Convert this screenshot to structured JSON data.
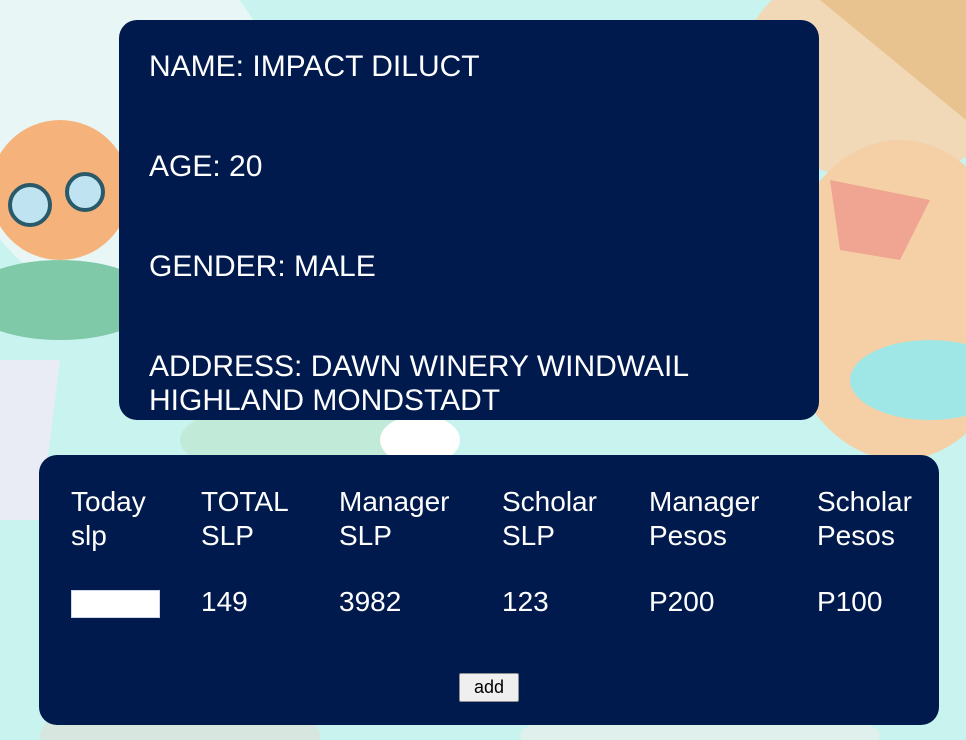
{
  "profile": {
    "name_label": "NAME:",
    "name_value": "IMPACT DILUCT",
    "age_label": "AGE:",
    "age_value": "20",
    "gender_label": "GENDER:",
    "gender_value": "MALE",
    "address_label": "ADDRESS:",
    "address_value": "DAWN WINERY WINDWAIL HIGHLAND MONDSTADT"
  },
  "slp_table": {
    "columns": [
      {
        "header": "Today slp",
        "value": ""
      },
      {
        "header": "TOTAL SLP",
        "value": "149"
      },
      {
        "header": "Manager SLP",
        "value": "3982"
      },
      {
        "header": "Scholar SLP",
        "value": "123"
      },
      {
        "header": "Manager Pesos",
        "value": "P200"
      },
      {
        "header": "Scholar Pesos",
        "value": "P100"
      }
    ],
    "today_input_value": "",
    "add_label": "add"
  },
  "colors": {
    "card_bg": "#001a4d",
    "text": "#ffffff",
    "page_bg": "#bff0ee"
  }
}
